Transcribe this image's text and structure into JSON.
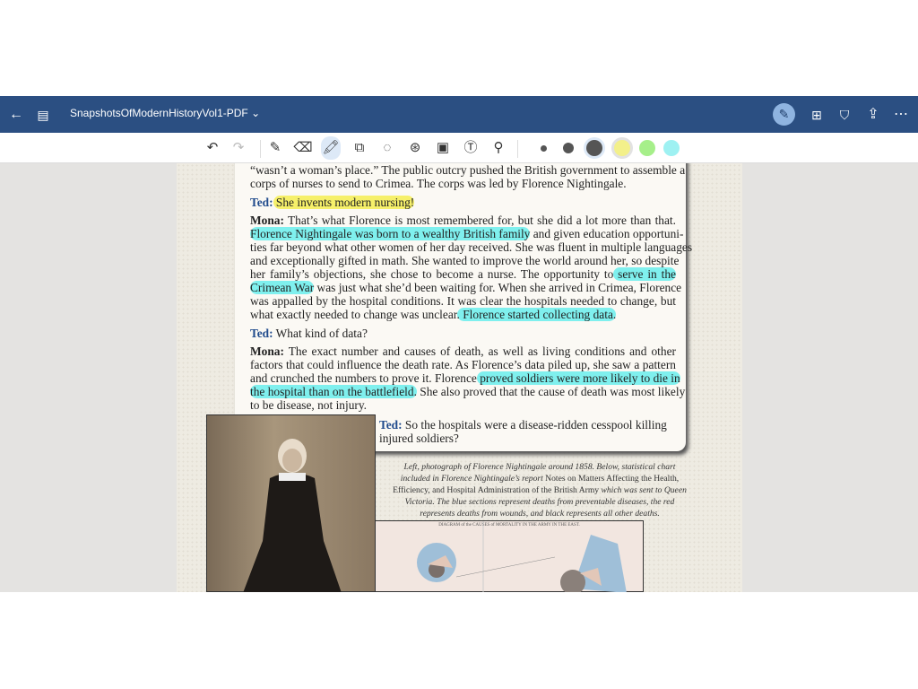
{
  "header": {
    "title": "SnapshotsOfModernHistoryVol1-PDF",
    "icons": [
      "back-arrow-icon",
      "sidebar-icon",
      "chevron-down-icon",
      "pen-mode-icon",
      "add-page-icon",
      "bookmark-icon",
      "share-icon",
      "more-icon"
    ]
  },
  "toolbar": {
    "tools": [
      "undo",
      "redo",
      "pen",
      "eraser",
      "highlighter",
      "shapes",
      "lasso",
      "sticker",
      "image",
      "text",
      "laser-pointer"
    ],
    "colors": {
      "stroke": "#555555",
      "yellow": "#f3f08a",
      "green": "#a6ef8a",
      "cyan": "#9ef1f2"
    }
  },
  "document": {
    "lines": [
      {
        "s": [
          {
            "t": "“wasn’t a woman’s place.” The public outcry pushed the British government to assemble a"
          }
        ]
      },
      {
        "last": true,
        "s": [
          {
            "t": "corps of nurses to send to Crimea. The corps was led by Florence Nightingale."
          }
        ]
      },
      {
        "gap": true
      },
      {
        "last": true,
        "s": [
          {
            "t": "Ted:",
            "k": "ted"
          },
          {
            "t": " She invents modern nursing!",
            "h": "y"
          }
        ]
      },
      {
        "gap": true
      },
      {
        "s": [
          {
            "t": "Mona:",
            "k": "spk"
          },
          {
            "t": " That’s what Florence is most remembered for, but she did a lot more than that."
          }
        ]
      },
      {
        "s": [
          {
            "t": "Florence Nightingale was born to a wealthy British family",
            "h": "c"
          },
          {
            "t": " and given education opportuni-"
          }
        ]
      },
      {
        "s": [
          {
            "t": "ties far beyond what other women of her day received. She was fluent in multiple languages"
          }
        ]
      },
      {
        "s": [
          {
            "t": "and exceptionally gifted in math. She wanted to improve the world around her, so despite"
          }
        ]
      },
      {
        "s": [
          {
            "t": "her family’s objections, she chose to become a nurse. The opportunity to"
          },
          {
            "t": " serve in the",
            "h": "c"
          }
        ]
      },
      {
        "s": [
          {
            "t": "Crimean War",
            "h": "c"
          },
          {
            "t": " was just what she’d been waiting for. When she arrived in Crimea, Florence"
          }
        ]
      },
      {
        "s": [
          {
            "t": "was appalled by the hospital conditions. It was clear the hospitals needed to change, but"
          }
        ]
      },
      {
        "last": true,
        "s": [
          {
            "t": "what exactly needed to change was unclear"
          },
          {
            "t": ". Florence started collecting data.",
            "h": "c"
          }
        ]
      },
      {
        "gap": true
      },
      {
        "last": true,
        "s": [
          {
            "t": "Ted:",
            "k": "ted"
          },
          {
            "t": " What kind of data?"
          }
        ]
      },
      {
        "gap": true
      },
      {
        "s": [
          {
            "t": "Mona:",
            "k": "spk"
          },
          {
            "t": " The exact number and causes of death, as well as living conditions and other"
          }
        ]
      },
      {
        "s": [
          {
            "t": "factors that could influence the death rate. As Florence’s data piled up, she saw a pattern"
          }
        ]
      },
      {
        "s": [
          {
            "t": "and crunched the numbers to prove it. Florence"
          },
          {
            "t": " proved soldiers were more likely to die in",
            "h": "c"
          }
        ]
      },
      {
        "s": [
          {
            "t": "the hospital than on the battlefield.",
            "h": "c"
          },
          {
            "t": " She also proved that the cause of death was most likely"
          }
        ]
      },
      {
        "last": true,
        "s": [
          {
            "t": "to be disease, not injury."
          }
        ]
      }
    ],
    "ted_question": [
      "Ted:",
      " So the hospitals were a disease-ridden cesspool killing",
      "injured soldiers?"
    ],
    "caption": [
      {
        "t": "Left, photograph of Florence Nightingale around 1858. Below, statistical chart included in Florence Nightingale’s report ",
        "i": true
      },
      {
        "t": "Notes on Matters Affecting the Health, Efficiency, and Hospital Administration of the British Army",
        "i": false
      },
      {
        "t": " which was sent to Queen Victoria. The blue sections represent deaths from preventable diseases, the red represents deaths from wounds, and black represents all other deaths.",
        "i": true
      }
    ],
    "chart_title": "DIAGRAM of the CAUSES of MORTALITY IN THE ARMY IN THE EAST."
  }
}
